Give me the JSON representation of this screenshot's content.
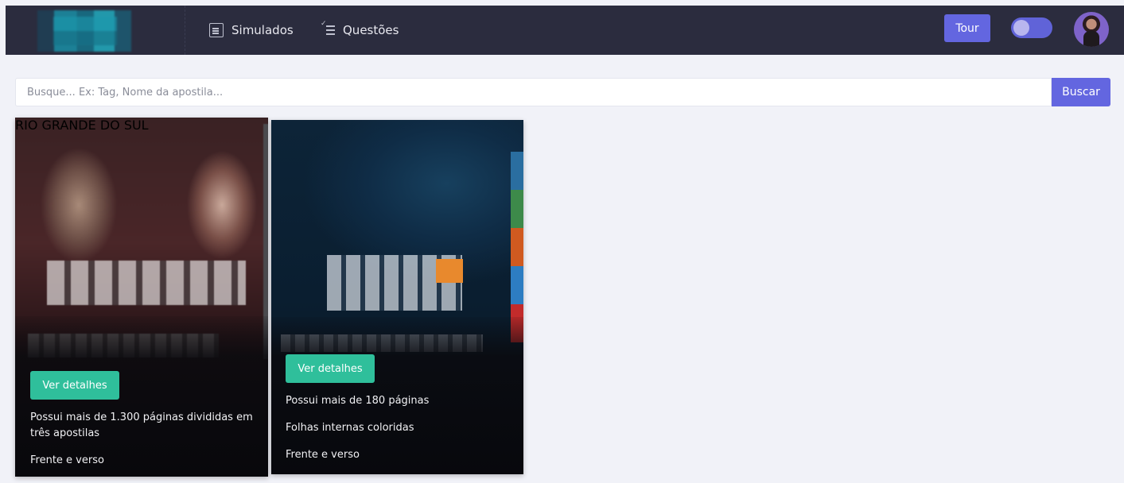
{
  "nav": {
    "items": [
      {
        "label": "Simulados",
        "icon": "document-icon"
      },
      {
        "label": "Questões",
        "icon": "checklist-icon"
      }
    ],
    "tour_label": "Tour"
  },
  "search": {
    "placeholder": "Busque... Ex: Tag, Nome da apostila...",
    "button_label": "Buscar"
  },
  "cards": [
    {
      "cover_label": "RIO GRANDE DO SUL",
      "button_label": "Ver detalhes",
      "features": [
        "Possui mais de 1.300 páginas divididas em três apostilas",
        "Frente e verso"
      ]
    },
    {
      "button_label": "Ver detalhes",
      "features": [
        "Possui mais de 180 páginas",
        "Folhas internas coloridas",
        "Frente e verso"
      ]
    }
  ],
  "colors": {
    "topbar": "#2b2c3e",
    "accent": "#6366e0",
    "button_green": "#2fbf9b",
    "background": "#f1f2f8"
  }
}
